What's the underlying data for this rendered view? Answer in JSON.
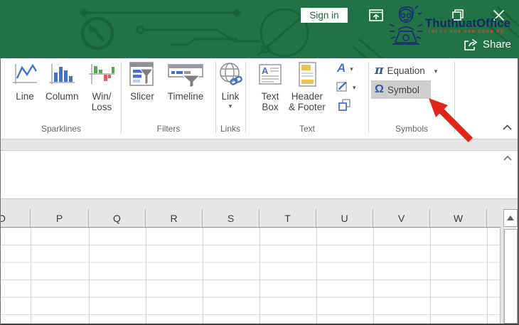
{
  "titlebar": {
    "sign_in": "Sign in",
    "share": "Share",
    "brand_name": "ThuthuatOffice",
    "brand_tagline": "TRI KỶ CỦA DÂN CÔNG SỞ"
  },
  "ribbon": {
    "sparklines": {
      "label": "Sparklines",
      "line": "Line",
      "column": "Column",
      "winloss_line1": "Win/",
      "winloss_line2": "Loss"
    },
    "filters": {
      "label": "Filters",
      "slicer": "Slicer",
      "timeline": "Timeline"
    },
    "links": {
      "label": "Links",
      "link": "Link",
      "caret": "▾"
    },
    "text": {
      "label": "Text",
      "textbox_line1": "Text",
      "textbox_line2": "Box",
      "hf_line1": "Header",
      "hf_line2": "& Footer",
      "wordart_glyph": "A",
      "caret": "▾"
    },
    "symbols": {
      "label": "Symbols",
      "equation": "Equation",
      "symbol": "Symbol",
      "pi_glyph": "π",
      "omega_glyph": "Ω",
      "caret": "▾"
    }
  },
  "sheet": {
    "columns": [
      "O",
      "P",
      "Q",
      "R",
      "S",
      "T",
      "U",
      "V",
      "W"
    ]
  },
  "colors": {
    "excel_green": "#217346",
    "icon_blue": "#4472c4",
    "symbol_highlight": "#d0cecd",
    "annotation_red": "#e2251b"
  }
}
